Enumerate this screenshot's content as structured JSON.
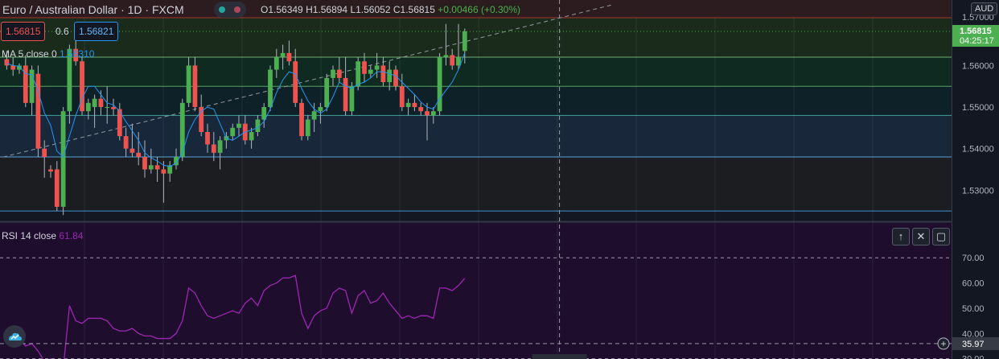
{
  "header": {
    "symbol": "Euro / Australian Dollar · 1D · FXCM",
    "ohlc_o": "O1.56349",
    "ohlc_h": "H1.56894",
    "ohlc_l": "L1.56052",
    "ohlc_c": "C1.56815",
    "change": "+0.00466 (+0.30%)"
  },
  "order": {
    "sell_price": "1.56815",
    "spread": "0.6",
    "buy_price": "1.56821"
  },
  "indicators": {
    "ma_label": "MA 5 close 0",
    "ma_value": "1.56310",
    "rsi_label": "RSI 14 close",
    "rsi_value": "61.84"
  },
  "axis": {
    "currency": "AUD",
    "current_price": "1.56815",
    "countdown": "04:25:17",
    "top_partial": "1.57000",
    "price_ticks": [
      "1.56000",
      "1.55000",
      "1.54000",
      "1.53000"
    ],
    "rsi_ticks": [
      "70.00",
      "60.00",
      "50.00",
      "40.00",
      "30.00"
    ],
    "crosshair_value": "35.97"
  },
  "colors": {
    "up": "#4caf50",
    "down": "#ef5350",
    "ma": "#2196f3",
    "rsi_line": "#9c27b0",
    "rsi_bg": "#1f0d2e"
  },
  "chart_data": {
    "type": "candlestick",
    "title": "Euro / Australian Dollar · 1D · FXCM",
    "ylim": [
      1.5225,
      1.5715
    ],
    "candles": [
      [
        1.5615,
        1.5635,
        1.559,
        1.56
      ],
      [
        1.56,
        1.562,
        1.5575,
        1.559
      ],
      [
        1.559,
        1.5605,
        1.558,
        1.56
      ],
      [
        1.56,
        1.5625,
        1.55,
        1.551
      ],
      [
        1.551,
        1.56,
        1.548,
        1.559
      ],
      [
        1.558,
        1.56,
        1.538,
        1.54
      ],
      [
        1.54,
        1.542,
        1.533,
        1.538
      ],
      [
        1.535,
        1.536,
        1.533,
        1.5345
      ],
      [
        1.535,
        1.537,
        1.525,
        1.526
      ],
      [
        1.526,
        1.55,
        1.524,
        1.549
      ],
      [
        1.549,
        1.565,
        1.546,
        1.564
      ],
      [
        1.564,
        1.566,
        1.56,
        1.561
      ],
      [
        1.561,
        1.562,
        1.548,
        1.549
      ],
      [
        1.549,
        1.552,
        1.547,
        1.551
      ],
      [
        1.55,
        1.553,
        1.545,
        1.552
      ],
      [
        1.552,
        1.554,
        1.548,
        1.55
      ],
      [
        1.55,
        1.555,
        1.546,
        1.55
      ],
      [
        1.55,
        1.552,
        1.548,
        1.5495
      ],
      [
        1.5495,
        1.551,
        1.542,
        1.543
      ],
      [
        1.543,
        1.545,
        1.538,
        1.54
      ],
      [
        1.54,
        1.546,
        1.538,
        1.539
      ],
      [
        1.539,
        1.544,
        1.536,
        1.538
      ],
      [
        1.538,
        1.542,
        1.533,
        1.535
      ],
      [
        1.535,
        1.54,
        1.534,
        1.536
      ],
      [
        1.536,
        1.538,
        1.532,
        1.535
      ],
      [
        1.535,
        1.537,
        1.527,
        1.534
      ],
      [
        1.534,
        1.537,
        1.532,
        1.536
      ],
      [
        1.536,
        1.54,
        1.535,
        1.538
      ],
      [
        1.538,
        1.552,
        1.537,
        1.551
      ],
      [
        1.551,
        1.562,
        1.55,
        1.56
      ],
      [
        1.56,
        1.562,
        1.549,
        1.55
      ],
      [
        1.55,
        1.553,
        1.543,
        1.544
      ],
      [
        1.544,
        1.546,
        1.539,
        1.541
      ],
      [
        1.541,
        1.544,
        1.537,
        1.539
      ],
      [
        1.539,
        1.543,
        1.535,
        1.542
      ],
      [
        1.542,
        1.544,
        1.54,
        1.543
      ],
      [
        1.543,
        1.546,
        1.542,
        1.545
      ],
      [
        1.545,
        1.548,
        1.543,
        1.546
      ],
      [
        1.546,
        1.548,
        1.541,
        1.542
      ],
      [
        1.542,
        1.545,
        1.54,
        1.544
      ],
      [
        1.544,
        1.548,
        1.543,
        1.547
      ],
      [
        1.547,
        1.551,
        1.545,
        1.55
      ],
      [
        1.55,
        1.56,
        1.549,
        1.559
      ],
      [
        1.559,
        1.564,
        1.557,
        1.562
      ],
      [
        1.562,
        1.565,
        1.559,
        1.563
      ],
      [
        1.563,
        1.566,
        1.56,
        1.561
      ],
      [
        1.561,
        1.564,
        1.55,
        1.551
      ],
      [
        1.551,
        1.552,
        1.542,
        1.543
      ],
      [
        1.543,
        1.548,
        1.542,
        1.547
      ],
      [
        1.547,
        1.551,
        1.544,
        1.549
      ],
      [
        1.549,
        1.551,
        1.546,
        1.55
      ],
      [
        1.55,
        1.558,
        1.549,
        1.557
      ],
      [
        1.557,
        1.56,
        1.555,
        1.559
      ],
      [
        1.559,
        1.562,
        1.556,
        1.557
      ],
      [
        1.557,
        1.562,
        1.548,
        1.549
      ],
      [
        1.549,
        1.556,
        1.548,
        1.555
      ],
      [
        1.555,
        1.562,
        1.554,
        1.561
      ],
      [
        1.561,
        1.563,
        1.556,
        1.558
      ],
      [
        1.558,
        1.56,
        1.557,
        1.559
      ],
      [
        1.559,
        1.563,
        1.557,
        1.56
      ],
      [
        1.56,
        1.562,
        1.555,
        1.556
      ],
      [
        1.556,
        1.561,
        1.554,
        1.559
      ],
      [
        1.559,
        1.56,
        1.554,
        1.555
      ],
      [
        1.555,
        1.558,
        1.549,
        1.55
      ],
      [
        1.55,
        1.552,
        1.548,
        1.551
      ],
      [
        1.551,
        1.553,
        1.549,
        1.55
      ],
      [
        1.55,
        1.551,
        1.548,
        1.549
      ],
      [
        1.549,
        1.551,
        1.542,
        1.548
      ],
      [
        1.548,
        1.55,
        1.546,
        1.549
      ],
      [
        1.549,
        1.563,
        1.548,
        1.562
      ],
      [
        1.562,
        1.57,
        1.56,
        1.5625
      ],
      [
        1.5625,
        1.564,
        1.559,
        1.56
      ],
      [
        1.56,
        1.57,
        1.559,
        1.562
      ],
      [
        1.5635,
        1.5689,
        1.5605,
        1.5682
      ]
    ],
    "rsi": [
      38,
      37,
      38,
      35,
      36,
      33,
      29,
      30,
      28,
      26,
      51,
      45,
      44,
      46,
      46,
      46,
      45,
      42,
      41,
      41,
      42,
      40,
      39,
      39,
      38,
      38,
      38,
      40,
      45,
      58,
      56,
      51,
      47,
      46,
      47,
      48,
      49,
      48,
      52,
      54,
      51,
      57,
      59,
      60,
      62,
      62,
      63,
      48,
      42,
      47,
      49,
      50,
      56,
      58,
      57,
      48,
      55,
      57,
      52,
      53,
      56,
      52,
      49,
      46,
      47,
      46,
      47,
      47,
      46,
      58,
      58,
      57,
      59,
      61.84
    ],
    "ma": [
      1.5605,
      1.56,
      1.5598,
      1.558,
      1.5578,
      1.5538,
      1.5486,
      1.5456,
      1.5394,
      1.538,
      1.543,
      1.548,
      1.552,
      1.555,
      1.555,
      1.553,
      1.551,
      1.5505,
      1.549,
      1.5465,
      1.5443,
      1.542,
      1.539,
      1.5378,
      1.537,
      1.536,
      1.5357,
      1.5365,
      1.539,
      1.544,
      1.547,
      1.549,
      1.55,
      1.5495,
      1.546,
      1.5425,
      1.542,
      1.543,
      1.544,
      1.5445,
      1.545,
      1.5465,
      1.5495,
      1.5535,
      1.5565,
      1.5585,
      1.558,
      1.5545,
      1.5515,
      1.5495,
      1.5485,
      1.5495,
      1.5525,
      1.556,
      1.555,
      1.5545,
      1.5555,
      1.556,
      1.557,
      1.5585,
      1.5585,
      1.558,
      1.5575,
      1.556,
      1.5545,
      1.553,
      1.5512,
      1.55,
      1.5495,
      1.552,
      1.554,
      1.556,
      1.559,
      1.5631
    ],
    "levels": [
      1.5715,
      1.562,
      1.555,
      1.548,
      1.538,
      1.525
    ],
    "trendline": [
      [
        -18,
        1.5312
      ],
      [
        97,
        1.5746
      ]
    ],
    "rsi_ylim": [
      23.5,
      79
    ],
    "rsi_levels": [
      70,
      30
    ],
    "crosshair_rsi": 35.97,
    "crosshair_index": 88.6
  }
}
